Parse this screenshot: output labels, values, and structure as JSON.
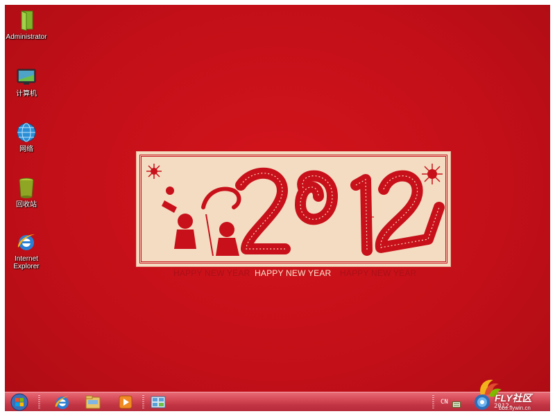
{
  "desktop": {
    "icons": [
      {
        "label": "Administrator",
        "icon": "folder-icon"
      },
      {
        "label": "计算机",
        "icon": "computer-icon"
      },
      {
        "label": "网络",
        "icon": "network-icon"
      },
      {
        "label": "回收站",
        "icon": "recycle-bin-icon"
      },
      {
        "label": "Internet Explorer",
        "icon": "internet-explorer-icon"
      }
    ]
  },
  "wallpaper": {
    "year_art": "2012",
    "greetings": [
      "HAPPY NEW YEAR",
      "HAPPY NEW YEAR",
      "HAPPY NEW YEAR"
    ],
    "colors": {
      "background": "#c8101a",
      "card": "#f3dcc2",
      "ink": "#c8101a"
    }
  },
  "taskbar": {
    "start_icon": "windows-start-orb-icon",
    "pinned": [
      {
        "name": "Internet Explorer",
        "icon": "internet-explorer-icon"
      },
      {
        "name": "Windows Explorer",
        "icon": "folder-library-icon"
      },
      {
        "name": "Windows Media Player",
        "icon": "media-player-icon"
      },
      {
        "name": "Control Panel",
        "icon": "control-panel-icon"
      }
    ],
    "tray": {
      "language": "CN",
      "clock_partial": "2012-"
    },
    "colors": {
      "top": "#e86a75",
      "bottom": "#b52a39"
    }
  },
  "watermark": {
    "brand": "FLY社区",
    "url": "bbs.flywin.cn"
  }
}
